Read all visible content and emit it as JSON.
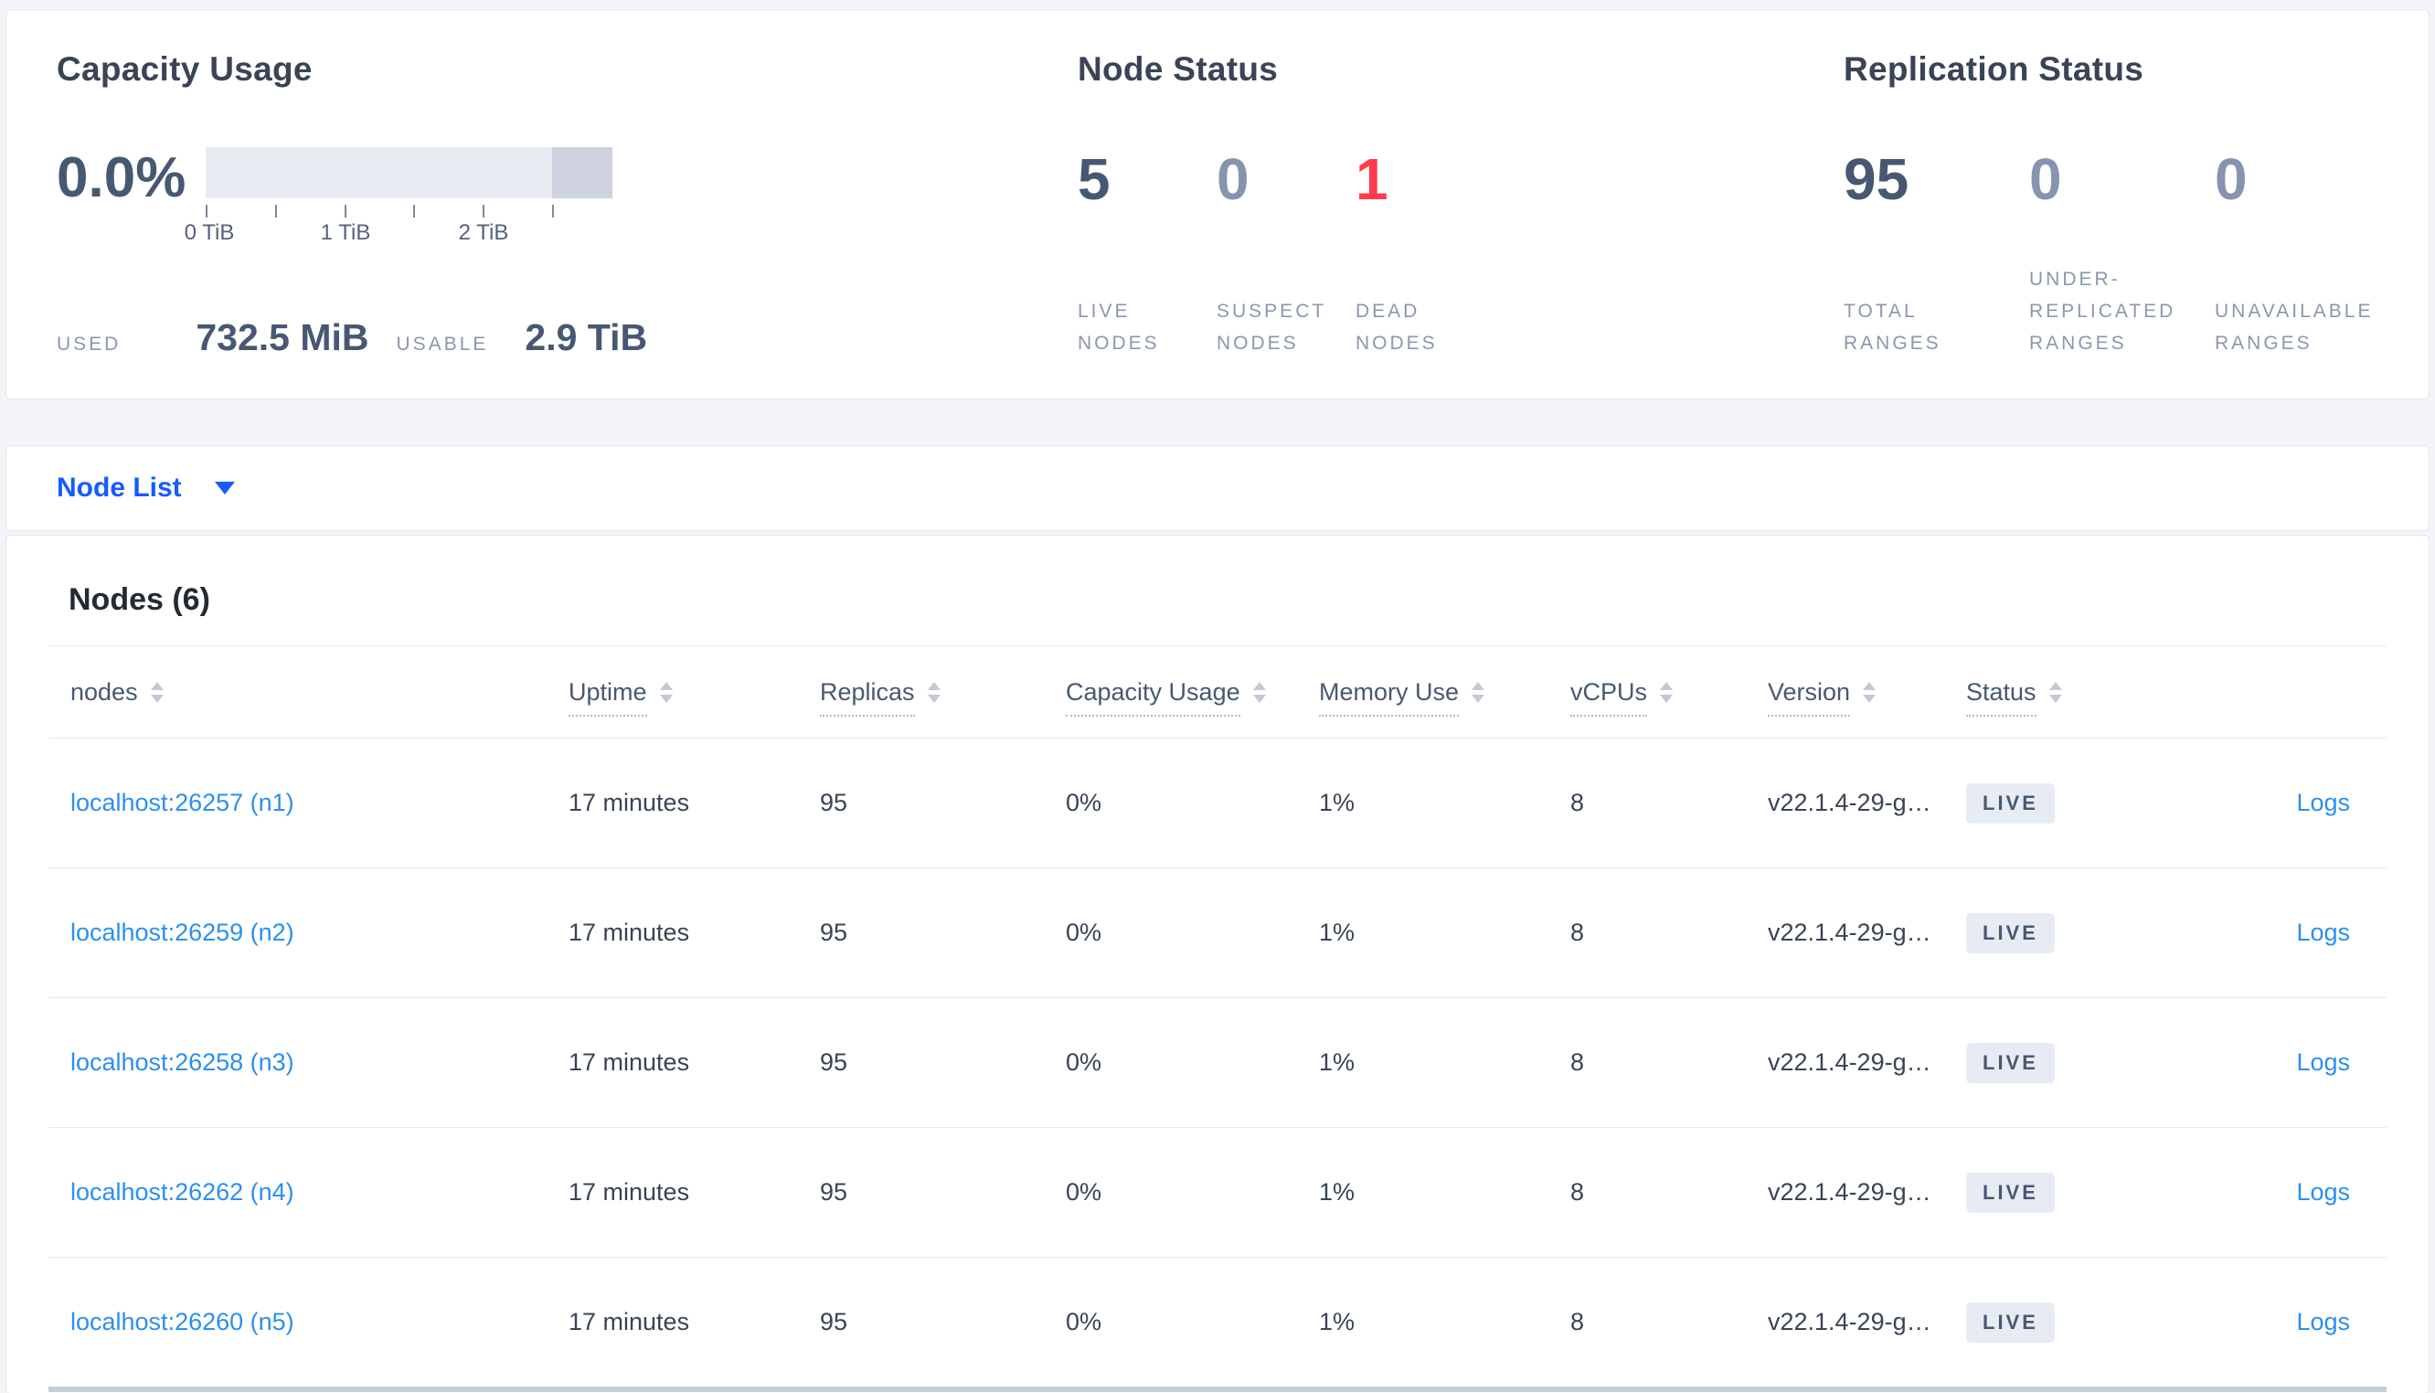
{
  "summary": {
    "capacity": {
      "title": "Capacity Usage",
      "percent": "0.0%",
      "ticks": [
        "0 TiB",
        "1 TiB",
        "2 TiB"
      ],
      "used_label": "USED",
      "used_value": "732.5 MiB",
      "usable_label": "USABLE",
      "usable_value": "2.9 TiB"
    },
    "node_status": {
      "title": "Node Status",
      "stats": [
        {
          "value": "5",
          "label": "LIVE NODES"
        },
        {
          "value": "0",
          "label": "SUSPECT NODES"
        },
        {
          "value": "1",
          "label": "DEAD NODES"
        }
      ]
    },
    "replication": {
      "title": "Replication Status",
      "stats": [
        {
          "value": "95",
          "label": "TOTAL RANGES"
        },
        {
          "value": "0",
          "label": "UNDER-REPLICATED RANGES"
        },
        {
          "value": "0",
          "label": "UNAVAILABLE RANGES"
        }
      ]
    }
  },
  "node_list_bar": {
    "label": "Node List",
    "caret_icon": "caret-down"
  },
  "nodes_table": {
    "heading": "Nodes (6)",
    "sort_icon": "sort-arrows",
    "columns": [
      {
        "label": "nodes"
      },
      {
        "label": "Uptime"
      },
      {
        "label": "Replicas"
      },
      {
        "label": "Capacity Usage"
      },
      {
        "label": "Memory Use"
      },
      {
        "label": "vCPUs"
      },
      {
        "label": "Version"
      },
      {
        "label": "Status"
      }
    ],
    "rows": [
      {
        "address": "localhost:26257 (n1)",
        "uptime": "17 minutes",
        "replicas": "95",
        "capacity_usage": "0%",
        "memory_use": "1%",
        "vcpus": "8",
        "version": "v22.1.4-29-g…",
        "status": "LIVE",
        "logs": "Logs"
      },
      {
        "address": "localhost:26259 (n2)",
        "uptime": "17 minutes",
        "replicas": "95",
        "capacity_usage": "0%",
        "memory_use": "1%",
        "vcpus": "8",
        "version": "v22.1.4-29-g…",
        "status": "LIVE",
        "logs": "Logs"
      },
      {
        "address": "localhost:26258 (n3)",
        "uptime": "17 minutes",
        "replicas": "95",
        "capacity_usage": "0%",
        "memory_use": "1%",
        "vcpus": "8",
        "version": "v22.1.4-29-g…",
        "status": "LIVE",
        "logs": "Logs"
      },
      {
        "address": "localhost:26262 (n4)",
        "uptime": "17 minutes",
        "replicas": "95",
        "capacity_usage": "0%",
        "memory_use": "1%",
        "vcpus": "8",
        "version": "v22.1.4-29-g…",
        "status": "LIVE",
        "logs": "Logs"
      },
      {
        "address": "localhost:26260 (n5)",
        "uptime": "17 minutes",
        "replicas": "95",
        "capacity_usage": "0%",
        "memory_use": "1%",
        "vcpus": "8",
        "version": "v22.1.4-29-g…",
        "status": "LIVE",
        "logs": "Logs"
      }
    ]
  },
  "colors": {
    "page_background": "#f3f5f9",
    "panel_border": "#e3e7ee",
    "primary_text": "#475872",
    "muted_label": "#8c96ae",
    "secondary_stat": "#8893af",
    "dead_red": "#ff3b4c",
    "action_blue": "#155bff",
    "link_blue": "#2b8fee",
    "bar_light": "#e9ebf2",
    "bar_dark": "#ced3df",
    "badge_background": "#e7ecf4"
  }
}
